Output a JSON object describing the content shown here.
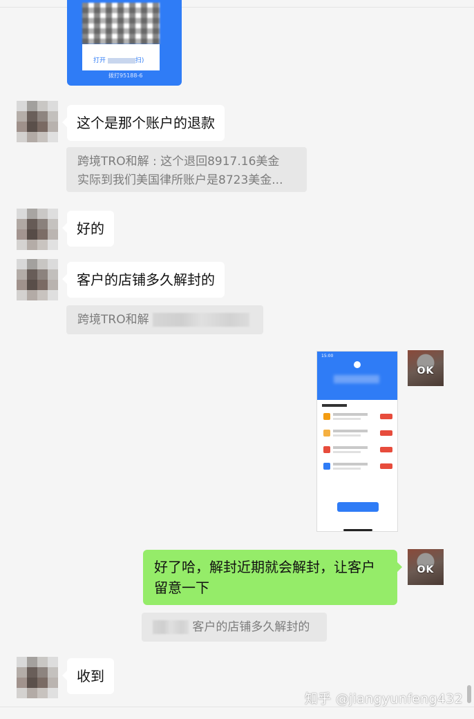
{
  "messages": {
    "m1": {
      "text": "这个是那个账户的退款"
    },
    "q1": {
      "line1": "跨境TRO和解 : 这个退回8917.16美金",
      "line2": "实际到我们美国律所账户是8723美金..."
    },
    "m2": {
      "text": "好的"
    },
    "m3": {
      "text": "客户的店铺多久解封的"
    },
    "q2": {
      "text": "跨境TRO和解"
    },
    "m4": {
      "text": "好了哈，解封近期就会解封，让客户留意一下"
    },
    "q3": {
      "text": "客户的店铺多久解封的"
    },
    "m5": {
      "text": "收到"
    }
  },
  "qr_card": {
    "button_text": "打开",
    "button_tail": "扫)",
    "tel": "拨打95188-6"
  },
  "phone_screenshot": {
    "time": "15:00"
  },
  "avatar_badge": "OK",
  "watermark": "知乎 @jiangyunfeng432",
  "colors": {
    "my_bubble": "#95ec69",
    "other_bubble": "#ffffff",
    "quote_bg": "#e7e7e7",
    "card_blue": "#2f7cf6"
  },
  "icons": {
    "avatar_left": "pixelated-avatar",
    "avatar_right": "brick-wall-avatar"
  }
}
